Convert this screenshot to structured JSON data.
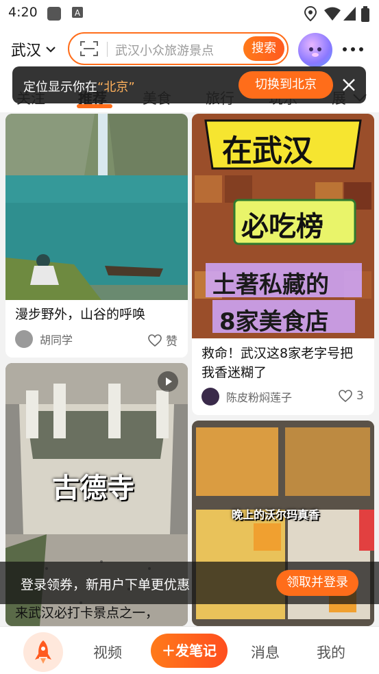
{
  "status_bar": {
    "time": "4:20"
  },
  "header": {
    "city": "武汉",
    "search_placeholder": "武汉小众旅游景点",
    "search_button": "搜索"
  },
  "tabs": [
    {
      "label": "关注"
    },
    {
      "label": "推荐"
    },
    {
      "label": "美食"
    },
    {
      "label": "旅行"
    },
    {
      "label": "玩乐"
    },
    {
      "label": "展"
    }
  ],
  "toast": {
    "prefix": "定位显示你在",
    "city": "“北京”",
    "button": "切换到北京"
  },
  "feed": [
    {
      "title": "漫步野外，山谷的呼唤",
      "author": "胡同学",
      "like": "赞"
    },
    {
      "overlay_lines": [
        "在武汉",
        "必吃榜",
        "土著私藏的",
        "8家美食店"
      ],
      "title": "救命！武汉这8家老字号把我香迷糊了",
      "author": "陈皮粉焖莲子",
      "like": "3"
    },
    {
      "overlay": "古德寺",
      "title": "来武汉必打卡景点之一，"
    },
    {
      "overlay": "晚上的沃尔玛真香"
    }
  ],
  "login_banner": {
    "text": "登录领券，新用户下单更优惠",
    "button": "领取并登录"
  },
  "bottom_nav": {
    "items": [
      "视频",
      "消息",
      "我的"
    ],
    "publish": "＋发笔记"
  },
  "colors": {
    "accent": "#ff6d1a"
  }
}
